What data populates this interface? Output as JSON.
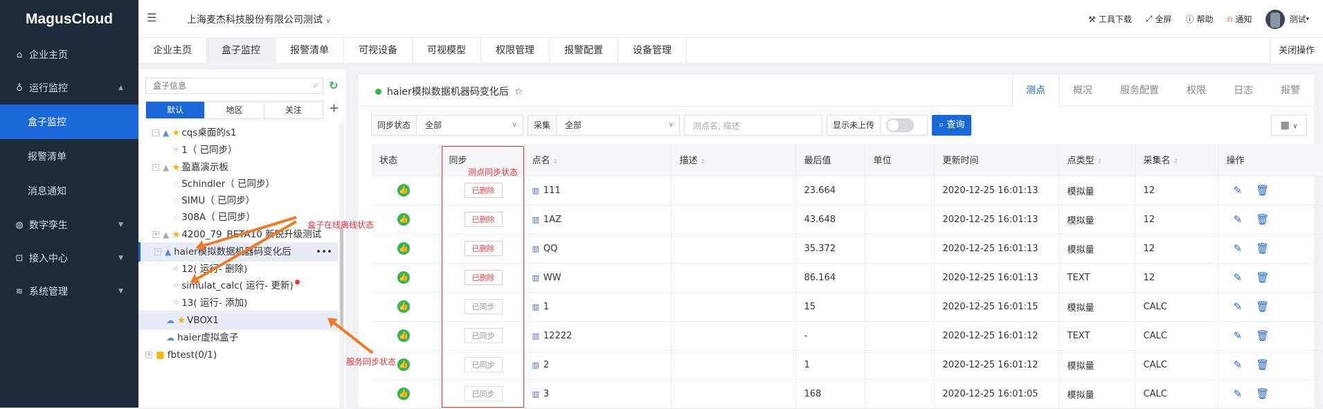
{
  "app": {
    "logo": "MagusCloud"
  },
  "sidebar": {
    "items": [
      {
        "label": "企业主页",
        "icon": "home-icon"
      },
      {
        "label": "运行监控",
        "icon": "bulb-icon"
      },
      {
        "label": "盒子监控",
        "active": true
      },
      {
        "label": "报警清单"
      },
      {
        "label": "消息通知"
      },
      {
        "label": "数字孪生",
        "icon": "globe-icon"
      },
      {
        "label": "接入中心",
        "icon": "plug-icon"
      },
      {
        "label": "系统管理",
        "icon": "layers-icon"
      }
    ]
  },
  "header": {
    "company": "上海麦杰科技股份有限公司测试",
    "actions": [
      "工具下载",
      "全屏",
      "帮助",
      "通知"
    ],
    "user": "测试"
  },
  "tabs": [
    "企业主页",
    "盒子监控",
    "报警清单",
    "可视设备",
    "可视模型",
    "权限管理",
    "报警配置",
    "设备管理"
  ],
  "tabs_close": "关闭操作",
  "left": {
    "search_placeholder": "盒子信息",
    "segments": [
      "默认",
      "地区",
      "关注"
    ],
    "tree": [
      "cqs桌面的s1",
      "1（ 已同步）",
      "盈嘉演示板",
      "Schindler（ 已同步）",
      "SIMU（ 已同步）",
      "308A（ 已同步）",
      "4200_79_BETA10 新锐升级测试",
      "haier模拟数据机器码变化后",
      "12( 运行- 删除)",
      "simulat_calc( 运行- 更新)",
      "13( 运行- 添加)",
      "VBOX1",
      "haier虚拟盒子",
      "fbtest(0/1)"
    ]
  },
  "main": {
    "title": "haier模拟数据机器码变化后",
    "tabs": [
      "测点",
      "概况",
      "服务配置",
      "权限",
      "日志",
      "报警"
    ],
    "filters": {
      "sync_label": "同步状态",
      "sync_value": "全部",
      "collect_label": "采集",
      "collect_value": "全部",
      "search_placeholder": "测点名, 描述",
      "show_unuploaded": "显示未上传",
      "query": "查询"
    },
    "columns": [
      "状态",
      "同步",
      "点名",
      "描述",
      "最后值",
      "单位",
      "更新时间",
      "点类型",
      "采集名",
      "操作"
    ],
    "rows": [
      {
        "sync": "已删除",
        "name": "111",
        "value": "23.664",
        "time": "2020-12-25 16:01:13",
        "type": "模拟量",
        "collect": "12"
      },
      {
        "sync": "已删除",
        "name": "1AZ",
        "value": "43.648",
        "time": "2020-12-25 16:01:13",
        "type": "模拟量",
        "collect": "12"
      },
      {
        "sync": "已删除",
        "name": "QQ",
        "value": "35.372",
        "time": "2020-12-25 16:01:13",
        "type": "模拟量",
        "collect": "12"
      },
      {
        "sync": "已删除",
        "name": "WW",
        "value": "86.164",
        "time": "2020-12-25 16:01:13",
        "type": "TEXT",
        "collect": "12"
      },
      {
        "sync": "已同步",
        "name": "1",
        "value": "15",
        "time": "2020-12-25 16:01:15",
        "type": "模拟量",
        "collect": "CALC"
      },
      {
        "sync": "已同步",
        "name": "12222",
        "value": "-",
        "time": "2020-12-25 16:01:12",
        "type": "TEXT",
        "collect": "CALC"
      },
      {
        "sync": "已同步",
        "name": "2",
        "value": "1",
        "time": "2020-12-25 16:01:12",
        "type": "模拟量",
        "collect": "CALC"
      },
      {
        "sync": "已同步",
        "name": "3",
        "value": "168",
        "time": "2020-12-25 16:01:05",
        "type": "模拟量",
        "collect": "CALC"
      }
    ]
  },
  "annotations": {
    "sync_state": "测点同步状态",
    "box_state": "盒子在线离线状态",
    "service_state": "服务同步状态"
  }
}
